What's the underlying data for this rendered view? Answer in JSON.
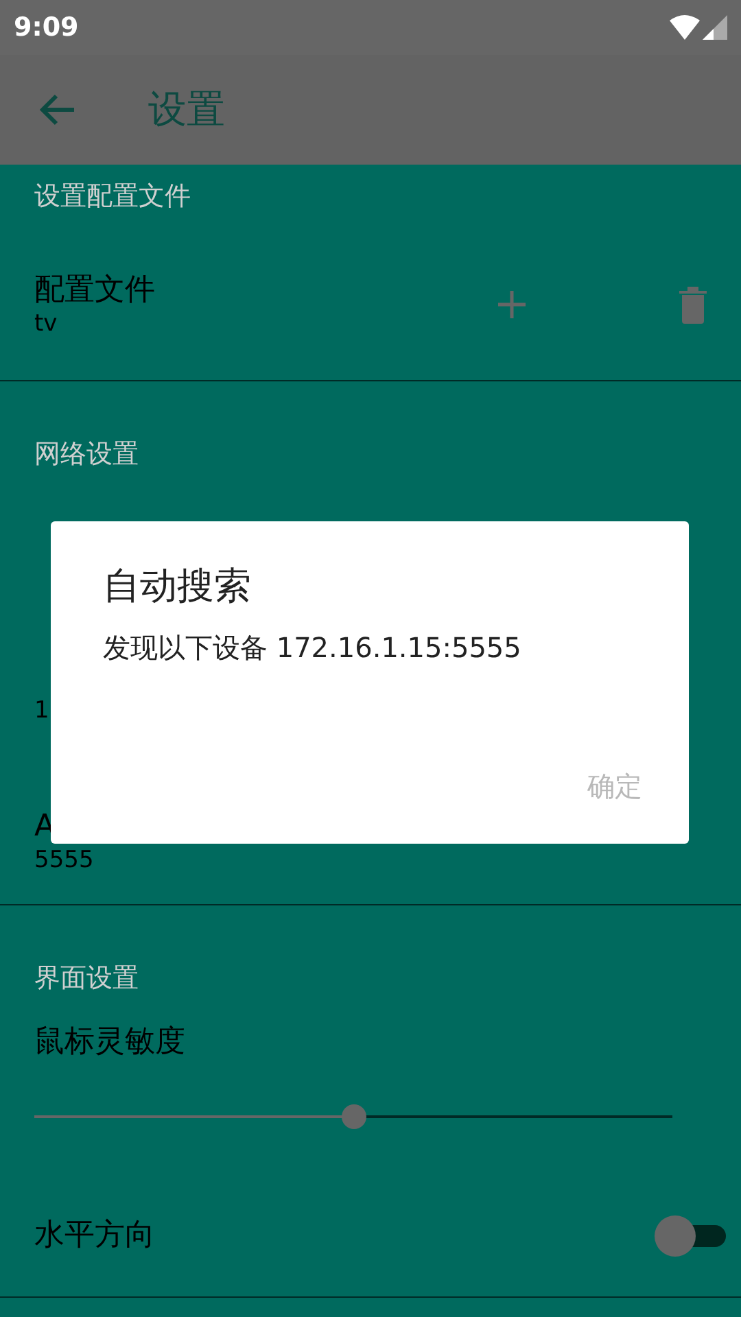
{
  "status_bar": {
    "time": "9:09"
  },
  "toolbar": {
    "title": "设置"
  },
  "sections": [
    {
      "header": "设置配置文件",
      "items": [
        {
          "kind": "profile",
          "title": "配置文件",
          "subtitle": "tv"
        }
      ]
    },
    {
      "header": "网络设置",
      "items": [
        {
          "kind": "text",
          "subtitle": "1"
        },
        {
          "kind": "text",
          "title": "A",
          "subtitle": "5555"
        }
      ]
    },
    {
      "header": "界面设置",
      "items": [
        {
          "kind": "slider",
          "title": "鼠标灵敏度",
          "level": 0.5
        },
        {
          "kind": "switch",
          "title": "水平方向",
          "on": false
        }
      ]
    }
  ],
  "dialog": {
    "title": "自动搜索",
    "message": "发现以下设备 172.16.1.15:5555",
    "button": {
      "label": "确定",
      "disabled": true
    }
  }
}
